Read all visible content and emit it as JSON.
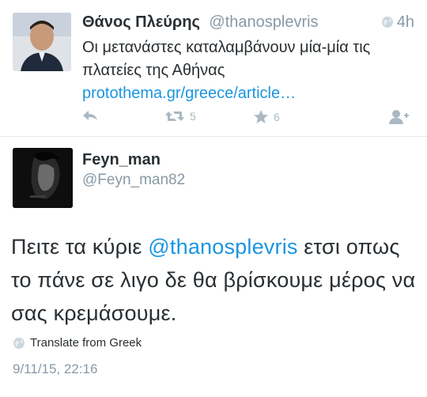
{
  "tweet1": {
    "author_name": "Θάνος Πλεύρης",
    "author_handle": "@thanosplevris",
    "time": "4h",
    "text_prefix": "Οι μετανάστες καταλαμβάνουν μία-μία τις πλατείες της Αθήνας ",
    "link_text": "protothema.gr/greece/article…",
    "retweet_count": "5",
    "favorite_count": "6"
  },
  "tweet2": {
    "author_name": "Feyn_man",
    "author_handle": "@Feyn_man82",
    "text_before": "Πειτε τα κύριε ",
    "mention": "@thanosplevris",
    "text_after": " ετσι οπως το πάνε σε λιγο δε θα βρίσκουμε μέρος να σας κρεμάσουμε.",
    "translate_label": "Translate from Greek",
    "date": "9/11/15, 22:16"
  },
  "colors": {
    "text": "#292f33",
    "muted": "#8899a6",
    "link": "#1b95e0",
    "icon": "#aab8c2"
  },
  "icons": [
    "globe-icon",
    "reply-icon",
    "retweet-icon",
    "favorite-icon",
    "follow-icon"
  ]
}
